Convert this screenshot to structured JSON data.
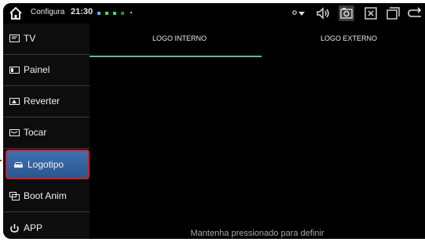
{
  "statusbar": {
    "app_name": "Configura",
    "time": "21:30",
    "home_icon": "home-icon",
    "right_icons": [
      "location-wifi-icon",
      "volume-icon",
      "screenshot-icon",
      "close-icon",
      "recent-apps-icon",
      "back-icon"
    ]
  },
  "sidebar": {
    "items": [
      {
        "label": "TV",
        "icon": "tv-icon"
      },
      {
        "label": "Painel",
        "icon": "panel-icon"
      },
      {
        "label": "Reverter",
        "icon": "reverse-camera-icon"
      },
      {
        "label": "Tocar",
        "icon": "touch-icon"
      },
      {
        "label": "Logotipo",
        "icon": "car-logo-icon"
      },
      {
        "label": "Boot Anim",
        "icon": "boot-animation-icon"
      },
      {
        "label": "APP",
        "icon": "app-icon"
      }
    ],
    "selected": "Logotipo"
  },
  "tabs": [
    {
      "label": "LOGO INTERNO",
      "active": true
    },
    {
      "label": "LOGO EXTERNO",
      "active": false
    }
  ],
  "hint": "Mantenha pressionado para definir",
  "colors": {
    "accent_underline": "#5fb7a6",
    "selected_bg": "#3a6aa8",
    "highlight_border": "#d21e28"
  }
}
